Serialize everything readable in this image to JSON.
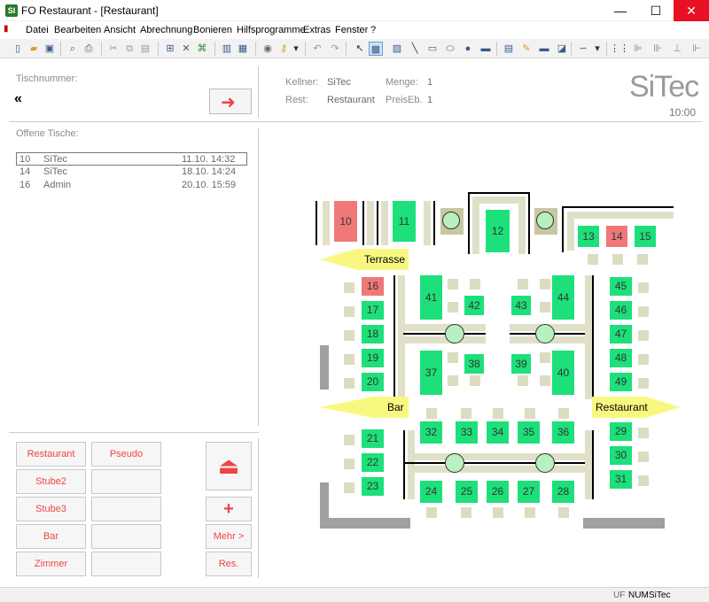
{
  "window": {
    "title": "FO Restaurant - [Restaurant]",
    "app_icon": "SI",
    "min": "—",
    "max": "☐",
    "close": "✕"
  },
  "menu": [
    "Datei",
    "Bearbeiten",
    "Ansicht",
    "Abrechnung",
    "Bonieren",
    "Hilfsprogramme",
    "Extras",
    "Fenster",
    "?"
  ],
  "left": {
    "tischnummer_label": "Tischnummer:",
    "back_icon": "«",
    "go_icon": "➜",
    "offene_label": "Offene Tische:",
    "open_tables": [
      {
        "nr": "10",
        "name": "SiTec",
        "time": "11.10. 14:32"
      },
      {
        "nr": "14",
        "name": "SiTec",
        "time": "18.10. 14:24"
      },
      {
        "nr": "16",
        "name": "Admin",
        "time": "20.10. 15:59"
      }
    ],
    "rooms": [
      "Restaurant",
      "Pseudo",
      "Stube2",
      "",
      "Stube3",
      "",
      "Bar",
      "",
      "Zimmer",
      ""
    ],
    "eject_icon": "⏏",
    "plus_icon": "+",
    "more_label": "Mehr >",
    "res_label": "Res."
  },
  "header": {
    "kellner_label": "Kellner:",
    "kellner_value": "SiTec",
    "menge_label": "Menge:",
    "menge_value": "1",
    "rest_label": "Rest:",
    "rest_value": "Restaurant",
    "preiseb_label": "PreisEb.",
    "preiseb_value": "1",
    "logo": "SiTec",
    "time": "10:00"
  },
  "floor": {
    "tables": [
      {
        "nr": "10",
        "status": "occupied"
      },
      {
        "nr": "11",
        "status": "free"
      },
      {
        "nr": "12",
        "status": "free"
      },
      {
        "nr": "13",
        "status": "free"
      },
      {
        "nr": "14",
        "status": "occupied"
      },
      {
        "nr": "15",
        "status": "free"
      },
      {
        "nr": "16",
        "status": "occupied"
      },
      {
        "nr": "17",
        "status": "free"
      },
      {
        "nr": "18",
        "status": "free"
      },
      {
        "nr": "19",
        "status": "free"
      },
      {
        "nr": "20",
        "status": "free"
      },
      {
        "nr": "21",
        "status": "free"
      },
      {
        "nr": "22",
        "status": "free"
      },
      {
        "nr": "23",
        "status": "free"
      },
      {
        "nr": "24",
        "status": "free"
      },
      {
        "nr": "25",
        "status": "free"
      },
      {
        "nr": "26",
        "status": "free"
      },
      {
        "nr": "27",
        "status": "free"
      },
      {
        "nr": "28",
        "status": "free"
      },
      {
        "nr": "29",
        "status": "free"
      },
      {
        "nr": "30",
        "status": "free"
      },
      {
        "nr": "31",
        "status": "free"
      },
      {
        "nr": "32",
        "status": "free"
      },
      {
        "nr": "33",
        "status": "free"
      },
      {
        "nr": "34",
        "status": "free"
      },
      {
        "nr": "35",
        "status": "free"
      },
      {
        "nr": "36",
        "status": "free"
      },
      {
        "nr": "37",
        "status": "free"
      },
      {
        "nr": "38",
        "status": "free"
      },
      {
        "nr": "39",
        "status": "free"
      },
      {
        "nr": "40",
        "status": "free"
      },
      {
        "nr": "41",
        "status": "free"
      },
      {
        "nr": "42",
        "status": "free"
      },
      {
        "nr": "43",
        "status": "free"
      },
      {
        "nr": "44",
        "status": "free"
      },
      {
        "nr": "45",
        "status": "free"
      },
      {
        "nr": "46",
        "status": "free"
      },
      {
        "nr": "47",
        "status": "free"
      },
      {
        "nr": "48",
        "status": "free"
      },
      {
        "nr": "49",
        "status": "free"
      }
    ],
    "signs": {
      "terrasse": "Terrasse",
      "bar": "Bar",
      "restaurant": "Restaurant"
    }
  },
  "colors": {
    "free": "#1de07a",
    "occupied": "#f07878",
    "sign": "#f8f880",
    "accent_red": "#e44"
  },
  "status": {
    "uf": "UF",
    "num": "NUM",
    "user": "SiTec"
  }
}
